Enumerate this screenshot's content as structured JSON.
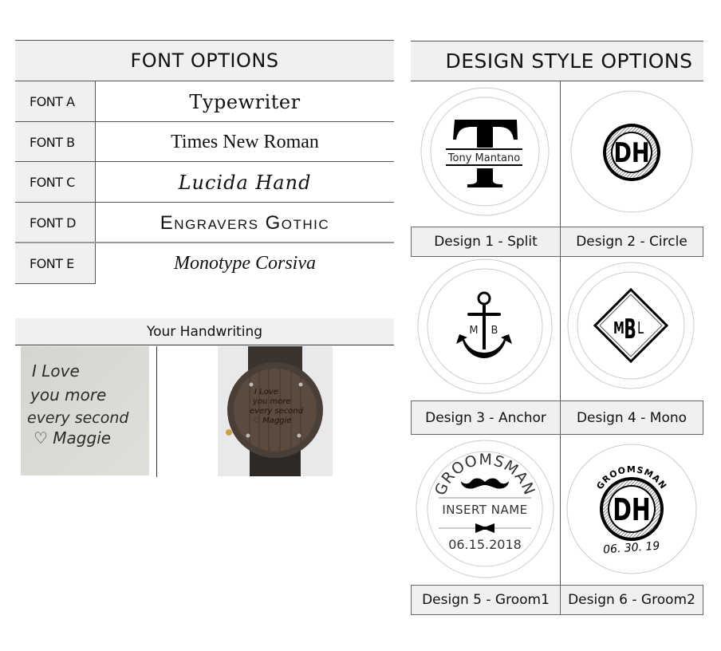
{
  "font_options": {
    "title": "FONT OPTIONS",
    "rows": [
      {
        "label": "FONT A",
        "sample": "Typewriter"
      },
      {
        "label": "FONT B",
        "sample": "Times New Roman"
      },
      {
        "label": "FONT C",
        "sample": "Lucida Hand"
      },
      {
        "label": "FONT D",
        "sample": "Engravers Gothic"
      },
      {
        "label": "FONT E",
        "sample": "Monotype Corsiva"
      }
    ]
  },
  "handwriting": {
    "title": "Your Handwriting",
    "note_lines": [
      "I Love",
      "you more",
      "every second",
      "♡ Maggie"
    ]
  },
  "design_styles": {
    "title": "DESIGN STYLE OPTIONS",
    "designs": [
      {
        "caption": "Design 1 - Split",
        "initial": "T",
        "name": "Tony Mantano"
      },
      {
        "caption": "Design 2 - Circle",
        "monogram": "DH"
      },
      {
        "caption": "Design 3 - Anchor",
        "left_initial": "M",
        "right_initial": "B"
      },
      {
        "caption": "Design 4 - Mono",
        "monogram": [
          "M",
          "B",
          "L"
        ]
      },
      {
        "caption": "Design 5 - Groom1",
        "arc_text": "GROOMSMAN",
        "name": "INSERT NAME",
        "date": "06.15.2018"
      },
      {
        "caption": "Design 6 - Groom2",
        "arc_text": "GROOMSMAN",
        "monogram": "DH",
        "date": "06. 30. 19"
      }
    ]
  }
}
